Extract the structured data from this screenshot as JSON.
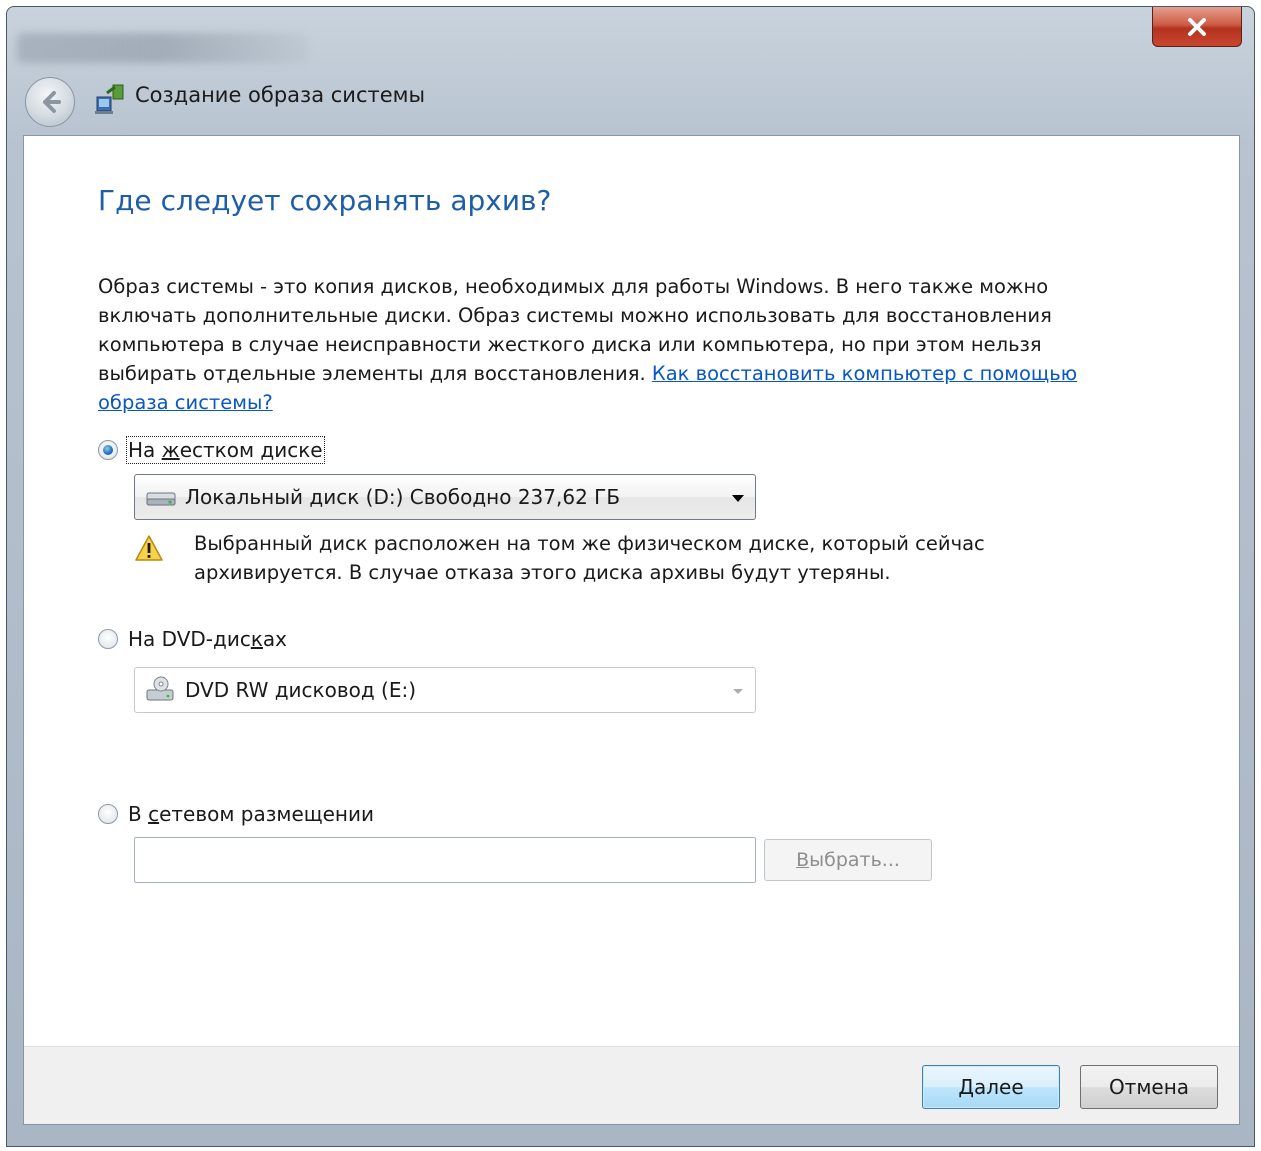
{
  "window": {
    "title": "Создание образа системы",
    "close_glyph": "X"
  },
  "main": {
    "heading": "Где следует сохранять архив?",
    "description": "Образ системы - это копия дисков, необходимых для работы Windows. В него также можно включать дополнительные диски. Образ системы можно использовать для восстановления компьютера в случае неисправности жесткого диска или компьютера, но при этом нельзя выбирать отдельные элементы для восстановления. ",
    "help_link": "Как восстановить компьютер с помощью образа системы?"
  },
  "options": {
    "hard_disk": {
      "label_pre": "На ",
      "label_access": "ж",
      "label_post": "естком диске",
      "selected": true,
      "combo_value": "Локальный диск (D:)  Свободно 237,62 ГБ",
      "warning": "Выбранный диск расположен на том же физическом диске, который сейчас архивируется. В случае отказа этого диска архивы будут утеряны."
    },
    "dvd": {
      "label_pre": "На DVD-дис",
      "label_access": "к",
      "label_post": "ах",
      "selected": false,
      "combo_value": "DVD RW дисковод (E:)"
    },
    "network": {
      "label_pre": "В ",
      "label_access": "с",
      "label_post": "етевом размещении",
      "selected": false,
      "input_value": "",
      "browse_access": "В",
      "browse_rest": "ыбрать..."
    }
  },
  "footer": {
    "next": "Далее",
    "cancel": "Отмена"
  },
  "icons": {
    "back": "back-arrow-icon",
    "app": "backup-icon",
    "hdd": "hard-drive-icon",
    "dvd": "dvd-drive-icon",
    "warning": "warning-icon",
    "close": "close-icon"
  },
  "colors": {
    "heading": "#1e5da7",
    "link": "#0a56c2",
    "close_button": "#c9472f",
    "primary_button": "#bee6fd"
  }
}
